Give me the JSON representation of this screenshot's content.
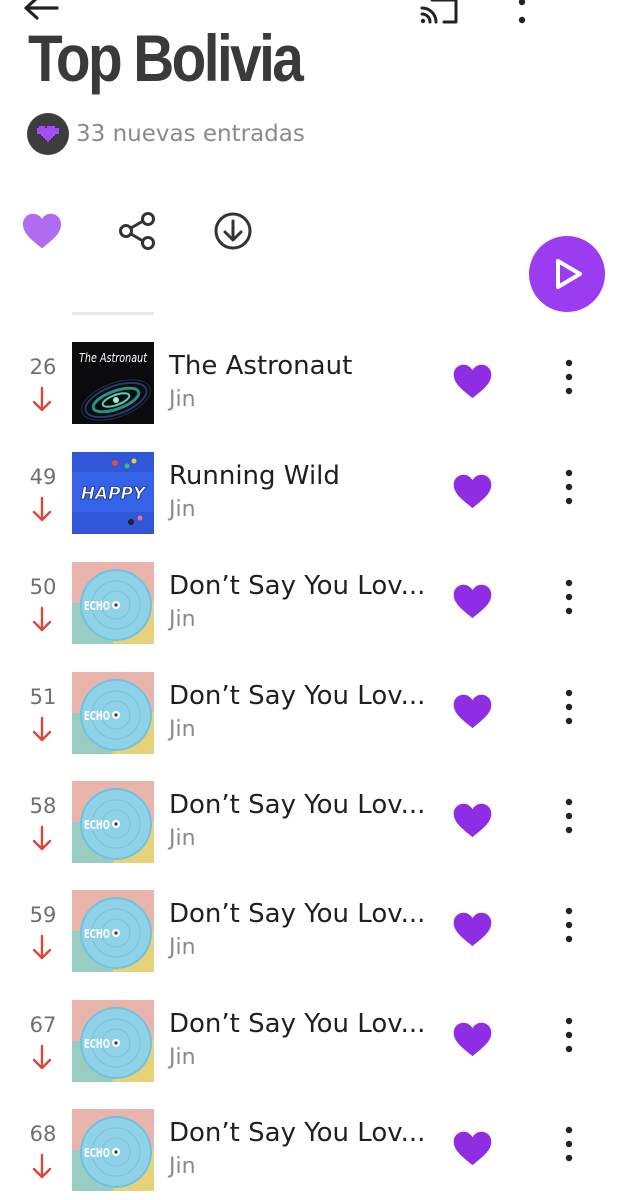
{
  "header": {
    "title": "Top Bolivia",
    "subtitle": "33 nuevas entradas"
  },
  "actions": {
    "like_icon": "heart-icon",
    "share_icon": "share-icon",
    "download_icon": "download-icon",
    "play_icon": "play-icon"
  },
  "colors": {
    "accent": "#9b3cf0",
    "trend_down": "#d9473a",
    "title": "#3a3a3a",
    "muted": "#8a8a8a"
  },
  "tracks": [
    {
      "rank": "26",
      "trend": "down",
      "title": "The Astronaut",
      "artist": "Jin",
      "art": "astronaut"
    },
    {
      "rank": "49",
      "trend": "down",
      "title": "Running Wild",
      "artist": "Jin",
      "art": "happy",
      "art_text": "HAPPY"
    },
    {
      "rank": "50",
      "trend": "down",
      "title": "Don’t Say You Lov...",
      "artist": "Jin",
      "art": "echo",
      "art_text": "ECHO"
    },
    {
      "rank": "51",
      "trend": "down",
      "title": "Don’t Say You Lov...",
      "artist": "Jin",
      "art": "echo",
      "art_text": "ECHO"
    },
    {
      "rank": "58",
      "trend": "down",
      "title": "Don’t Say You Lov...",
      "artist": "Jin",
      "art": "echo",
      "art_text": "ECHO"
    },
    {
      "rank": "59",
      "trend": "down",
      "title": "Don’t Say You Lov...",
      "artist": "Jin",
      "art": "echo",
      "art_text": "ECHO"
    },
    {
      "rank": "67",
      "trend": "down",
      "title": "Don’t Say You Lov...",
      "artist": "Jin",
      "art": "echo",
      "art_text": "ECHO"
    },
    {
      "rank": "68",
      "trend": "down",
      "title": "Don’t Say You Lov...",
      "artist": "Jin",
      "art": "echo",
      "art_text": "ECHO"
    }
  ],
  "astronaut_art_text": "The Astronaut"
}
